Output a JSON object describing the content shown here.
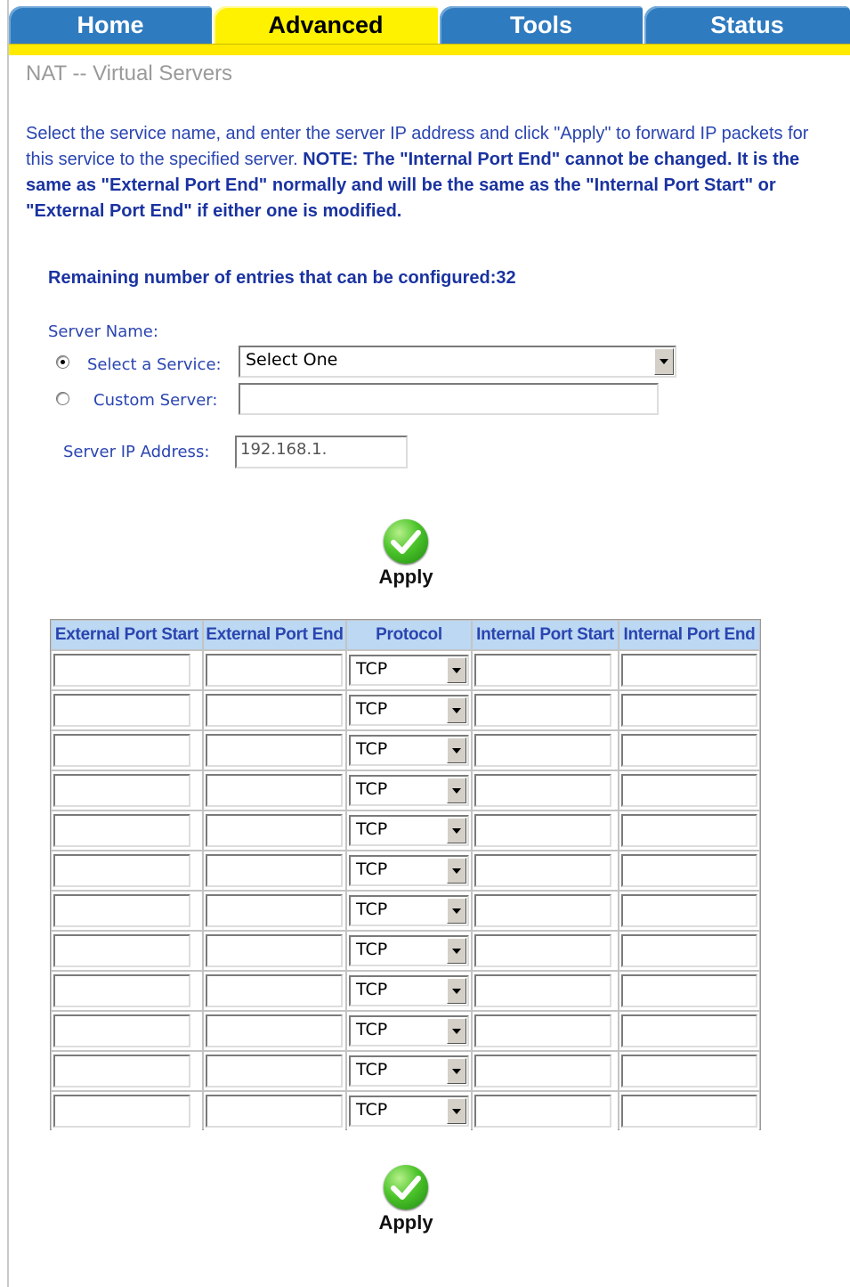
{
  "nav": {
    "tabs": [
      {
        "label": "Home"
      },
      {
        "label": "Advanced"
      },
      {
        "label": "Tools"
      },
      {
        "label": "Status"
      }
    ]
  },
  "page": {
    "title": "NAT -- Virtual Servers",
    "desc_plain": "Select the service name, and enter the server IP address and click \"Apply\" to forward IP packets for this service to the specified server. ",
    "desc_bold": "NOTE: The \"Internal Port End\" cannot be changed. It is the same as \"External Port End\" normally and will be the same as the \"Internal Port Start\" or \"External Port End\" if either one is modified.",
    "remaining": "Remaining number of entries that can be configured:32"
  },
  "form": {
    "server_name_label": "Server Name:",
    "select_service_label": "Select a Service:",
    "select_service_value": "Select One",
    "custom_server_label": "Custom Server:",
    "custom_server_value": "",
    "server_ip_label": "Server IP Address:",
    "server_ip_value": "192.168.1.",
    "apply_label": "Apply"
  },
  "table": {
    "headers": [
      "External Port Start",
      "External Port End",
      "Protocol",
      "Internal Port Start",
      "Internal Port End"
    ],
    "rows": [
      {
        "ext_start": "",
        "ext_end": "",
        "protocol": "TCP",
        "int_start": "",
        "int_end": ""
      },
      {
        "ext_start": "",
        "ext_end": "",
        "protocol": "TCP",
        "int_start": "",
        "int_end": ""
      },
      {
        "ext_start": "",
        "ext_end": "",
        "protocol": "TCP",
        "int_start": "",
        "int_end": ""
      },
      {
        "ext_start": "",
        "ext_end": "",
        "protocol": "TCP",
        "int_start": "",
        "int_end": ""
      },
      {
        "ext_start": "",
        "ext_end": "",
        "protocol": "TCP",
        "int_start": "",
        "int_end": ""
      },
      {
        "ext_start": "",
        "ext_end": "",
        "protocol": "TCP",
        "int_start": "",
        "int_end": ""
      },
      {
        "ext_start": "",
        "ext_end": "",
        "protocol": "TCP",
        "int_start": "",
        "int_end": ""
      },
      {
        "ext_start": "",
        "ext_end": "",
        "protocol": "TCP",
        "int_start": "",
        "int_end": ""
      },
      {
        "ext_start": "",
        "ext_end": "",
        "protocol": "TCP",
        "int_start": "",
        "int_end": ""
      },
      {
        "ext_start": "",
        "ext_end": "",
        "protocol": "TCP",
        "int_start": "",
        "int_end": ""
      },
      {
        "ext_start": "",
        "ext_end": "",
        "protocol": "TCP",
        "int_start": "",
        "int_end": ""
      },
      {
        "ext_start": "",
        "ext_end": "",
        "protocol": "TCP",
        "int_start": "",
        "int_end": ""
      }
    ]
  }
}
